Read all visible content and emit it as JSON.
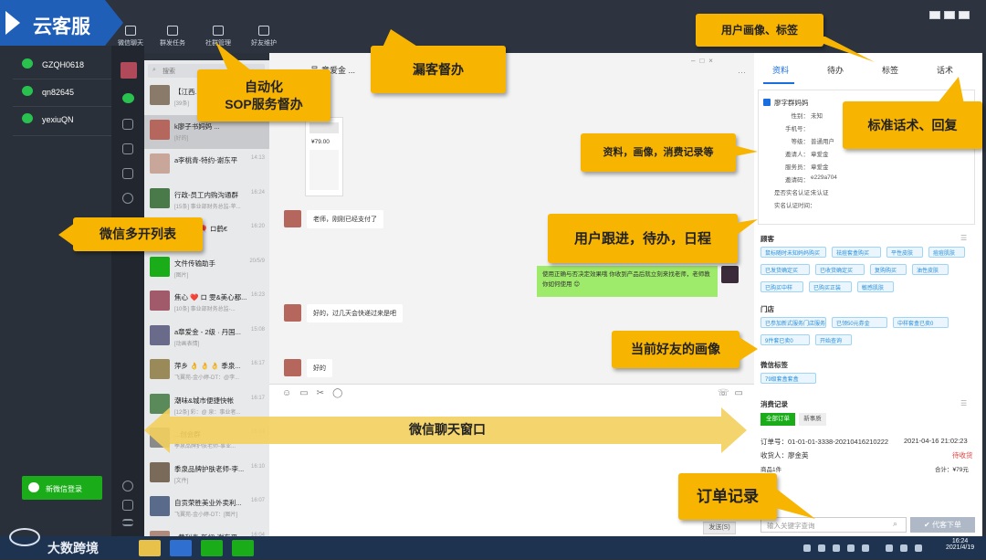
{
  "brand": "云客服",
  "top_nav": [
    "微信聊天",
    "群发任务",
    "社群管理",
    "好友维护"
  ],
  "accounts": [
    "GZQH0618",
    "qn82645",
    "yexiuQN"
  ],
  "new_account_button": "新微信登录",
  "search_placeholder": "搜索",
  "chat_list": [
    {
      "name": "【江西...",
      "preview": "[39条]",
      "time": ""
    },
    {
      "name": "k廖子书妈妈 ...",
      "preview": "[好的]",
      "time": ""
    },
    {
      "name": "a李桃青-特约-谢东平",
      "preview": "",
      "time": "14:13"
    },
    {
      "name": "行政-员工内购沟通群",
      "preview": "[15条] 事业部财务总监-苹...",
      "time": "16:24"
    },
    {
      "name": "...乐美...🎈 ロ鹤€",
      "preview": "",
      "time": "16:20"
    },
    {
      "name": "文件传输助手",
      "preview": "[图片]",
      "time": "20/5/9"
    },
    {
      "name": "焦心 ❤️ ロ 雯&美心都...",
      "preview": "[10条] 事业部财务总监-...",
      "time": "16:23"
    },
    {
      "name": "a章爱金 - 2级 · 丹国...",
      "preview": "[动画表情]",
      "time": "15:08"
    },
    {
      "name": "萍乡 👌 👌 👌 季泉...",
      "preview": "飞翼苑-金小婷-DT：@李...",
      "time": "16:17"
    },
    {
      "name": "潮味&城市便捷快帐",
      "preview": "[12条] 彩：@ 泉：事业者...",
      "time": "16:17"
    },
    {
      "name": "...创会群",
      "preview": "季泉品牌护肤老师-事业...",
      "time": "16:14"
    },
    {
      "name": "季泉品牌护肤老师-李...",
      "preview": "[文件]",
      "time": "16:10"
    },
    {
      "name": "自贡荣胜美业外卖利...",
      "preview": "飞翼苑-金小婷-DT：[图片]",
      "time": "16:07"
    },
    {
      "name": "a黄利青-新初-谢东平",
      "preview": "食物所二维码加地址个护...",
      "time": "16:04"
    }
  ],
  "chat": {
    "title_frag": "号-章爱金 ...",
    "product_price": "¥79.00",
    "messages": [
      {
        "side": "left",
        "text": "老师，刚刚已经支付了"
      },
      {
        "side": "right",
        "text": "使用正确与否决定效果哦 你收到产品后就立刻来找老师，老师教你如何使用 😊"
      },
      {
        "side": "left",
        "text": "好的，过几天会快递过来是吧"
      },
      {
        "side": "left",
        "text": "好的"
      }
    ],
    "send_label": "发送(S)"
  },
  "right_tabs": [
    "资料",
    "待办",
    "标签",
    "话术"
  ],
  "profile": {
    "name": "廖字群妈妈",
    "fields": [
      [
        "性别：",
        "未知"
      ],
      [
        "手机号：",
        ""
      ],
      [
        "等级：",
        "普通用户"
      ],
      [
        "邀请人：",
        "章爱金"
      ],
      [
        "服务员：",
        "章爱金"
      ],
      [
        "邀请码：",
        "e229a704"
      ],
      [
        "是否实名认证：",
        "未认证"
      ],
      [
        "实名认证时间：",
        ""
      ]
    ]
  },
  "customer_section": "顾客",
  "customer_tags": [
    "鼠标随时未知妈妈购买",
    "祛痘套盒购买",
    "平性皮肤",
    "痘痘肌肤",
    "已发货确定买",
    "已收货确定买",
    "复购购买",
    "油性皮肤",
    "已购买中样",
    "已购买正装",
    "敏感肌肤"
  ],
  "store_section": "门店",
  "store_tags": [
    "已参加新式服务门店服务",
    "已领50元券金",
    "中样套盒已卖0",
    "9件套已卖0",
    "开始查询"
  ],
  "wechat_tag_section": "微信标签",
  "wechat_tags": [
    "79级套盒套盒"
  ],
  "orders_section": "消费记录",
  "order_tabs": [
    "全部订单",
    "新事质"
  ],
  "order": {
    "number": "订单号：01-01-01-3338-20210416210222",
    "time": "2021-04-16 21:02:23",
    "receiver": "收货人：廖金英",
    "status": "待收货",
    "items": "商品1件",
    "total": "合计：¥79元"
  },
  "keyword_placeholder": "输入关键字查询",
  "keyword_button": "✔ 代客下单",
  "callouts": {
    "user_profile": "用户画像、标签",
    "sop": "自动化\nSOP服务督办",
    "leakage": "漏客督办",
    "scripts": "标准话术、回复",
    "resources": "资料，画像，消费记录等",
    "wechat_multi": "微信多开列表",
    "followup": "用户跟进，待办，日程",
    "friend_profile": "当前好友的画像",
    "chat_window": "微信聊天窗口",
    "orders": "订单记录"
  },
  "taskbar": {
    "time": "16:24",
    "date": "2021/4/19"
  },
  "watermark": "大数跨境"
}
